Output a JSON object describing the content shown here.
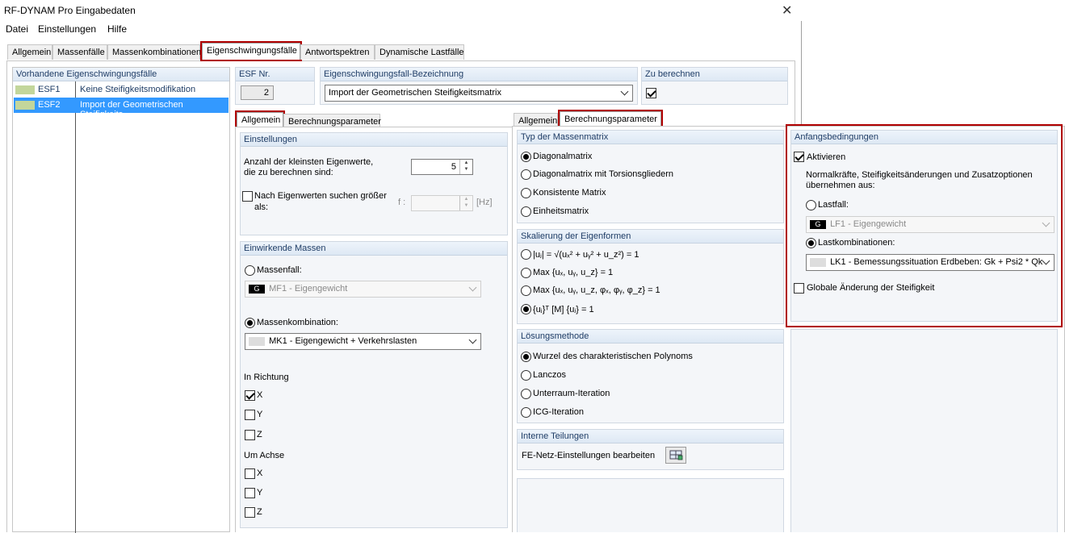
{
  "window": {
    "title": "RF-DYNAM Pro Eingabedaten"
  },
  "menu": [
    "Datei",
    "Einstellungen",
    "Hilfe"
  ],
  "main_tabs": [
    "Allgemein",
    "Massenfälle",
    "Massenkombinationen",
    "Eigenschwingungsfälle",
    "Antwortspektren",
    "Dynamische Lastfälle"
  ],
  "list": {
    "header": "Vorhandene Eigenschwingungsfälle",
    "rows": [
      {
        "id": "ESF1",
        "name": "Keine Steifigkeitsmodifikation",
        "color": "#c3d69b"
      },
      {
        "id": "ESF2",
        "name": "Import der Geometrischen Steifigkeits",
        "color": "#c3d69b"
      }
    ]
  },
  "esf_nr": {
    "label": "ESF Nr.",
    "value": "2"
  },
  "bezeichnung": {
    "label": "Eigenschwingungsfall-Bezeichnung",
    "value": "Import der Geometrischen Steifigkeitsmatrix"
  },
  "zu_berechnen": {
    "label": "Zu berechnen"
  },
  "left_tabs": [
    "Allgemein",
    "Berechnungsparameter"
  ],
  "einstellungen": {
    "header": "Einstellungen",
    "anzahl_label_1": "Anzahl der kleinsten Eigenwerte,",
    "anzahl_label_2": "die zu berechnen sind:",
    "anzahl_value": "5",
    "suchen_label_1": "Nach Eigenwerten suchen größer",
    "suchen_label_2": "als:",
    "f_label": "f :",
    "unit": "[Hz]"
  },
  "massen": {
    "header": "Einwirkende Massen",
    "massenfall_label": "Massenfall:",
    "massenfall_tag": "G",
    "massenfall_value": "MF1 - Eigengewicht",
    "mk_label": "Massenkombination:",
    "mk_value": "MK1 - Eigengewicht + Verkehrslasten",
    "richtung_label": "In Richtung",
    "achse_label": "Um Achse",
    "axes": [
      "X",
      "Y",
      "Z"
    ]
  },
  "right_tabs": [
    "Allgemein",
    "Berechnungsparameter"
  ],
  "massenmatrix": {
    "header": "Typ der Massenmatrix",
    "options": [
      "Diagonalmatrix",
      "Diagonalmatrix mit Torsionsgliedern",
      "Konsistente Matrix",
      "Einheitsmatrix"
    ]
  },
  "skalierung": {
    "header": "Skalierung der Eigenformen",
    "options": [
      "|uⱼ| = √(uₓ² + uᵧ² + u_z²) = 1",
      "Max {uₓ, uᵧ, u_z} = 1",
      "Max {uₓ, uᵧ, u_z, φₓ, φᵧ, φ_z} = 1",
      "{uⱼ}ᵀ [M] {uⱼ} = 1"
    ]
  },
  "loesung": {
    "header": "Lösungsmethode",
    "options": [
      "Wurzel des charakteristischen Polynoms",
      "Lanczos",
      "Unterraum-Iteration",
      "ICG-Iteration"
    ]
  },
  "teilungen": {
    "header": "Interne Teilungen",
    "label": "FE-Netz-Einstellungen bearbeiten"
  },
  "anfang": {
    "header": "Anfangsbedingungen",
    "aktivieren": "Aktivieren",
    "hinweis_1": "Normalkräfte, Steifigkeitsänderungen und Zusatzoptionen",
    "hinweis_2": "übernehmen aus:",
    "lastfall_label": "Lastfall:",
    "lastfall_tag": "G",
    "lastfall_value": "LF1 - Eigengewicht",
    "lk_label": "Lastkombinationen:",
    "lk_value": "LK1 - Bemessungssituation Erdbeben: Gk + Psi2 * Qk",
    "global_label": "Globale Änderung der Steifigkeit"
  },
  "colors": {
    "accent": "#b00000",
    "selection": "#3399ff",
    "header_text": "#1f3d66"
  }
}
